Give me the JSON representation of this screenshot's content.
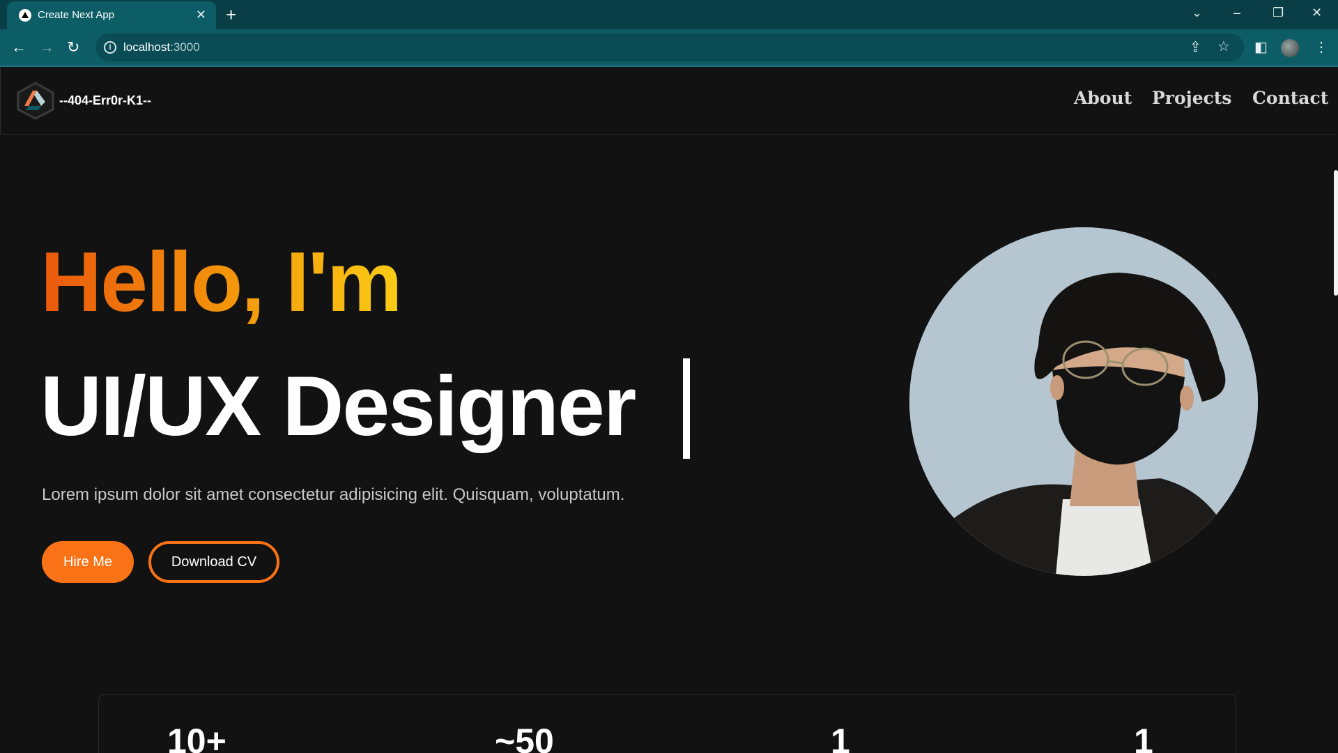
{
  "browser": {
    "tab_title": "Create Next App",
    "tab_close": "✕",
    "new_tab": "+",
    "url_host": "localhost",
    "url_port": ":3000",
    "window_controls": {
      "chevron": "⌄",
      "minimize": "–",
      "restore": "❐",
      "close": "✕"
    },
    "nav": {
      "back": "←",
      "forward": "→",
      "reload": "↻"
    },
    "toolbar_icons": {
      "share": "⇪",
      "bookmark": "☆",
      "sidepanel": "◧",
      "menu": "⋮"
    }
  },
  "navbar": {
    "brand": "--404-Err0r-K1--",
    "links": [
      "About",
      "Projects",
      "Contact"
    ]
  },
  "hero": {
    "greeting": "Hello, I'm",
    "role": "UI/UX Designer",
    "tagline": "Lorem ipsum dolor sit amet consectetur adipisicing elit. Quisquam, voluptatum.",
    "hire_button": "Hire Me",
    "cv_button": "Download CV"
  },
  "stats": {
    "values": [
      "10+",
      "~50",
      "1",
      "1"
    ]
  },
  "colors": {
    "accent": "#f97316",
    "gradient_start": "#ea580c",
    "gradient_end": "#facc15",
    "background": "#121212",
    "browser_frame": "#0d5d66"
  }
}
